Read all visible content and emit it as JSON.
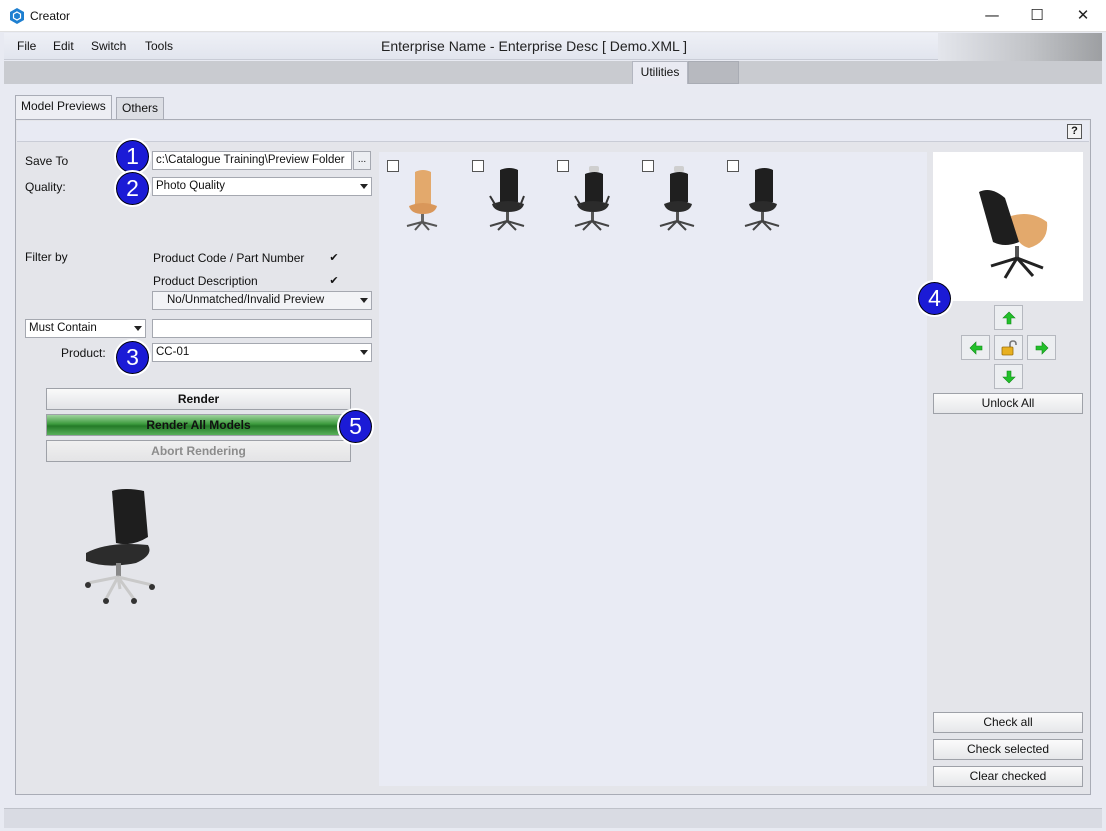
{
  "window": {
    "title": "Creator",
    "minimize": "—",
    "maximize": "☐",
    "close": "✕"
  },
  "menu": {
    "file": "File",
    "edit": "Edit",
    "switch": "Switch",
    "tools": "Tools"
  },
  "header": {
    "enterprise_title": "Enterprise Name - Enterprise Desc [ Demo.XML ]"
  },
  "top_tabs": {
    "utilities": "Utilities"
  },
  "tabs": {
    "model_previews": "Model Previews",
    "others": "Others"
  },
  "help": {
    "label": "?"
  },
  "form": {
    "save_to_label": "Save To",
    "save_to_value": "c:\\Catalogue Training\\Preview Folder",
    "browse_label": "...",
    "quality_label": "Quality:",
    "quality_value": "Photo Quality",
    "filter_by_label": "Filter by",
    "product_code_label": "Product Code / Part Number",
    "product_desc_label": "Product Description",
    "preview_filter_value": "No/Unmatched/Invalid Preview",
    "must_contain_value": "Must Contain",
    "must_contain_text": "",
    "product_label": "Product:",
    "product_value": "CC-01",
    "check_mark": "✔"
  },
  "actions": {
    "render": "Render",
    "render_all": "Render All Models",
    "abort": "Abort Rendering"
  },
  "badges": [
    "1",
    "2",
    "3",
    "4",
    "5"
  ],
  "right_panel": {
    "unlock_all": "Unlock All",
    "check_all": "Check all",
    "check_selected": "Check selected",
    "clear_checked": "Clear checked"
  },
  "thumbnails": [
    {
      "name": "chair-1",
      "seat_color": "#e3a96c"
    },
    {
      "name": "chair-2",
      "seat_color": "#2a2a2a"
    },
    {
      "name": "chair-3",
      "seat_color": "#2a2a2a"
    },
    {
      "name": "chair-4",
      "seat_color": "#2a2a2a"
    },
    {
      "name": "chair-5",
      "seat_color": "#2a2a2a"
    }
  ],
  "colors": {
    "badge": "#1b1bd6",
    "render_all_green": "#3c9b3d",
    "wood_seat": "#e3a96c"
  }
}
